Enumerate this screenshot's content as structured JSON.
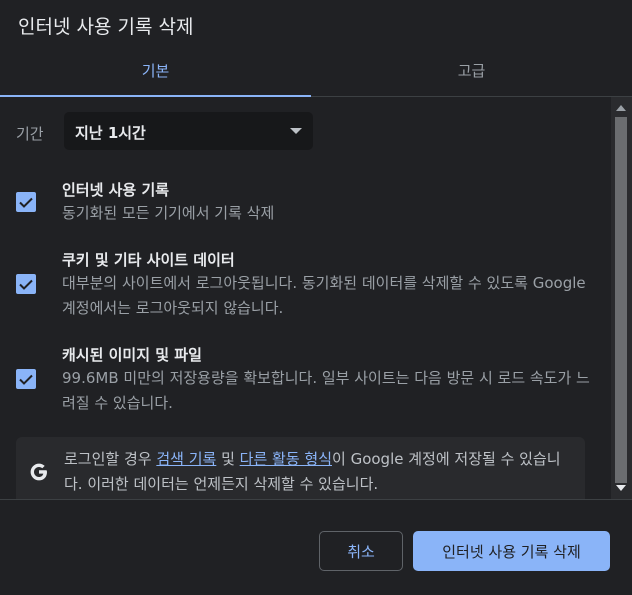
{
  "dialog": {
    "title": "인터넷 사용 기록 삭제"
  },
  "tabs": [
    {
      "label": "기본",
      "active": true
    },
    {
      "label": "고급",
      "active": false
    }
  ],
  "time_range": {
    "label": "기간",
    "value": "지난 1시간"
  },
  "options": [
    {
      "title": "인터넷 사용 기록",
      "desc": "동기화된 모든 기기에서 기록 삭제",
      "checked": true
    },
    {
      "title": "쿠키 및 기타 사이트 데이터",
      "desc": "대부분의 사이트에서 로그아웃됩니다. 동기화된 데이터를 삭제할 수 있도록 Google 계정에서는 로그아웃되지 않습니다.",
      "checked": true
    },
    {
      "title": "캐시된 이미지 및 파일",
      "desc": "99.6MB 미만의 저장용량을 확보합니다. 일부 사이트는 다음 방문 시 로드 속도가 느려질 수 있습니다.",
      "checked": true
    }
  ],
  "info": {
    "text_before": "로그인할 경우 ",
    "link1": "검색 기록",
    "text_mid": " 및 ",
    "link2": "다른 활동 형식",
    "text_after": "이 Google 계정에 저장될 수 있습니다. 이러한 데이터는 언제든지 삭제할 수 있습니다."
  },
  "buttons": {
    "cancel": "취소",
    "confirm": "인터넷 사용 기록 삭제"
  },
  "colors": {
    "accent": "#8ab4f8",
    "background": "#202124",
    "surface": "#292a2d"
  }
}
